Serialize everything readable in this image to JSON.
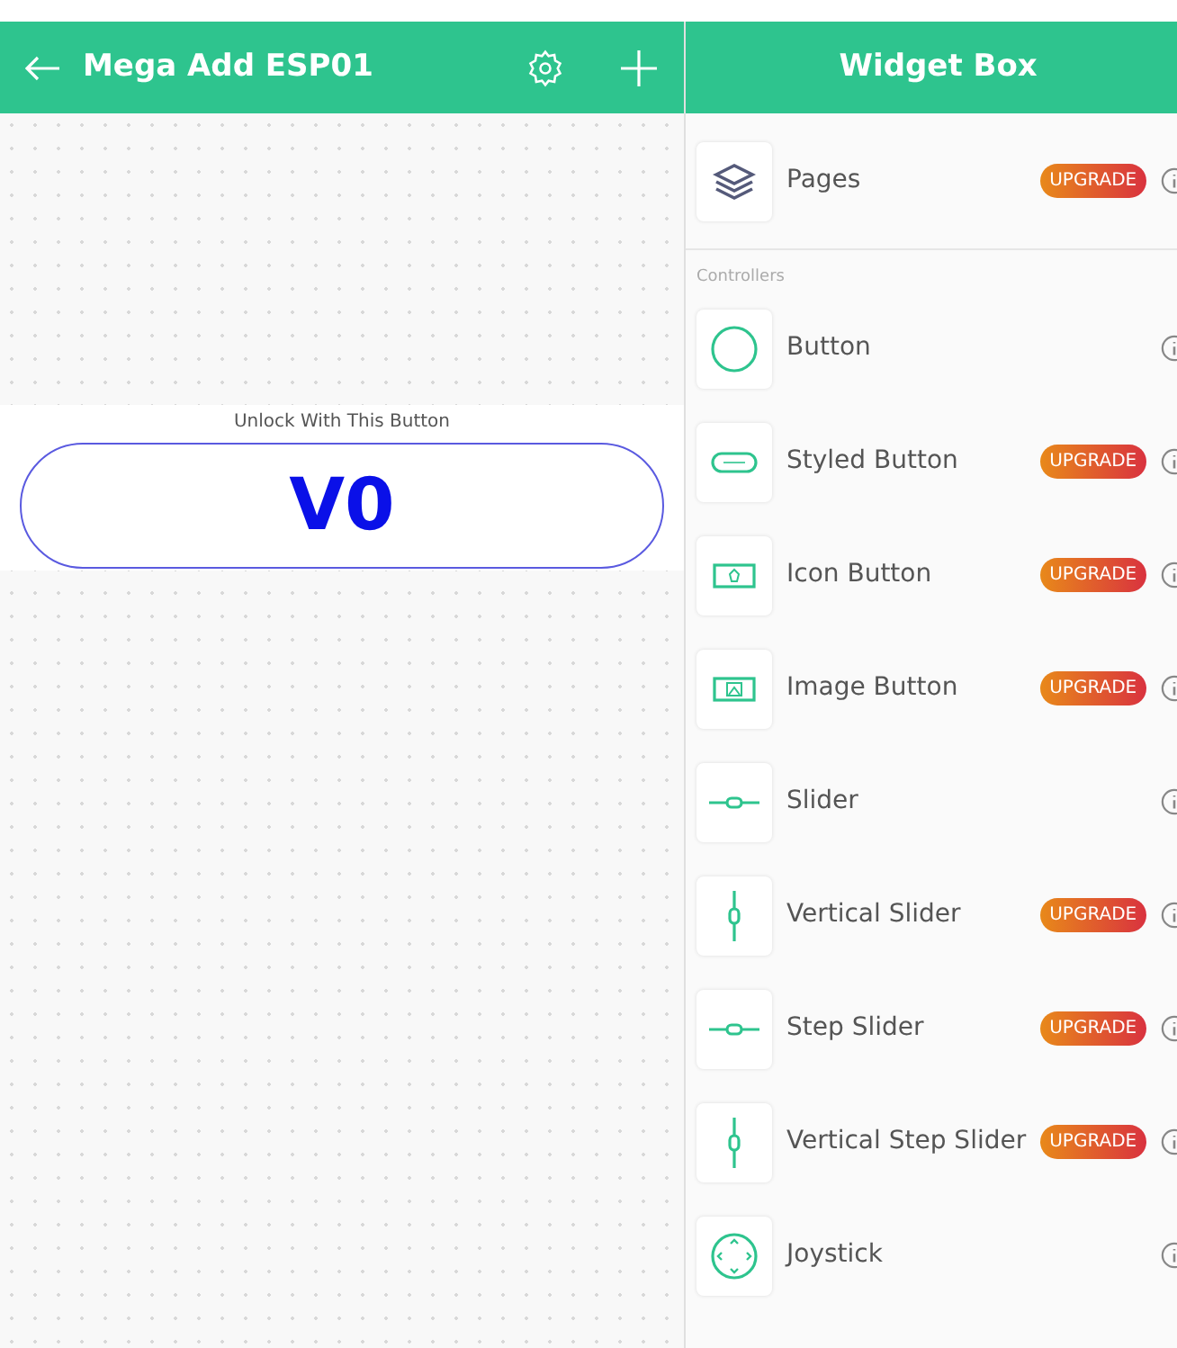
{
  "project": {
    "title": "Mega Add ESP01"
  },
  "widget": {
    "label": "Unlock With This Button",
    "pin": "V0"
  },
  "widget_box": {
    "title": "Widget Box",
    "top_items": [
      {
        "kind": "layers",
        "name": "Pages",
        "upgrade": true,
        "badge": "UPGRADE"
      }
    ],
    "section": "Controllers",
    "items": [
      {
        "kind": "circle",
        "name": "Button",
        "upgrade": false
      },
      {
        "kind": "styled",
        "name": "Styled Button",
        "upgrade": true,
        "badge": "UPGRADE"
      },
      {
        "kind": "iconbtn",
        "name": "Icon Button",
        "upgrade": true,
        "badge": "UPGRADE"
      },
      {
        "kind": "image",
        "name": "Image Button",
        "upgrade": true,
        "badge": "UPGRADE"
      },
      {
        "kind": "hslider",
        "name": "Slider",
        "upgrade": false
      },
      {
        "kind": "vslider",
        "name": "Vertical Slider",
        "upgrade": true,
        "badge": "UPGRADE"
      },
      {
        "kind": "hslider",
        "name": "Step Slider",
        "upgrade": true,
        "badge": "UPGRADE"
      },
      {
        "kind": "vslider",
        "name": "Vertical Step Slider",
        "upgrade": true,
        "badge": "UPGRADE"
      },
      {
        "kind": "joystick",
        "name": "Joystick",
        "upgrade": false
      }
    ]
  }
}
